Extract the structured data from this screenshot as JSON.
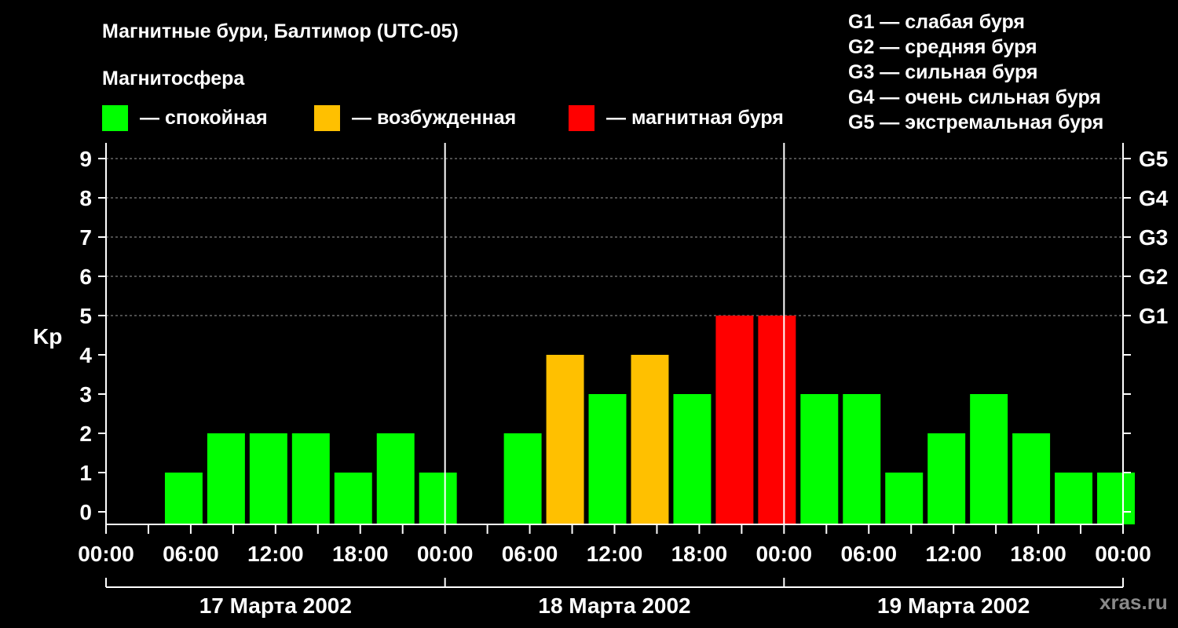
{
  "chart_data": {
    "type": "bar",
    "title": "Магнитные бури, Балтимор (UTC-05)",
    "ylabel": "Kp",
    "ylim": [
      0,
      9
    ],
    "y_ticks": [
      "0",
      "1",
      "2",
      "3",
      "4",
      "5",
      "6",
      "7",
      "8",
      "9"
    ],
    "right_ticks": [
      {
        "kp": 5,
        "label": "G1"
      },
      {
        "kp": 6,
        "label": "G2"
      },
      {
        "kp": 7,
        "label": "G3"
      },
      {
        "kp": 8,
        "label": "G4"
      },
      {
        "kp": 9,
        "label": "G5"
      }
    ],
    "x_tick_labels": [
      "00:00",
      "06:00",
      "12:00",
      "18:00",
      "00:00",
      "06:00",
      "12:00",
      "18:00",
      "00:00",
      "06:00",
      "12:00",
      "18:00",
      "00:00"
    ],
    "days": [
      "17 Марта 2002",
      "18 Марта 2002",
      "19 Марта 2002"
    ],
    "magnetosphere_title": "Магнитосфера",
    "categories_legend": [
      {
        "label": "— спокойная",
        "color": "#00ff00"
      },
      {
        "label": "— возбужденная",
        "color": "#ffc000"
      },
      {
        "label": "— магнитная буря",
        "color": "#ff0000"
      }
    ],
    "storm_legend": [
      "G1 — слабая буря",
      "G2 — средняя буря",
      "G3 — сильная буря",
      "G4 — очень сильная буря",
      "G5 — экстремальная буря"
    ],
    "colors": {
      "quiet": "#00ff00",
      "active": "#ffc000",
      "storm": "#ff0000"
    },
    "values": [
      0,
      1,
      2,
      2,
      2,
      1,
      2,
      1,
      0,
      2,
      4,
      3,
      4,
      3,
      5,
      5,
      3,
      3,
      1,
      2,
      3,
      2,
      1,
      1
    ],
    "grid": "dashed horizontal at Kp 5–9; vertical lines at day boundaries",
    "legend_placement": "top",
    "watermark": "xras.ru"
  }
}
